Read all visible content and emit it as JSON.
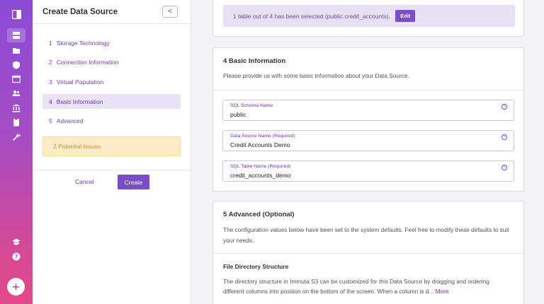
{
  "rail": {
    "icons": [
      "panel-toggle-icon",
      "data-sources-icon",
      "projects-icon",
      "governance-icon",
      "queries-icon",
      "users-icon",
      "institution-icon",
      "audit-icon",
      "tools-icon",
      "tutorials-icon",
      "help-icon"
    ],
    "add_label": "+",
    "accent": "#8a4bd6"
  },
  "wizard": {
    "title": "Create Data Source",
    "collapse_label": "<",
    "steps": [
      {
        "num": "1",
        "label": "Storage Technology"
      },
      {
        "num": "2",
        "label": "Connection Information"
      },
      {
        "num": "3",
        "label": "Virtual Population"
      },
      {
        "num": "4",
        "label": "Basic Information"
      },
      {
        "num": "5",
        "label": "Advanced"
      }
    ],
    "issues_label": "2 Potential Issues",
    "cancel_label": "Cancel",
    "create_label": "Create"
  },
  "top": {
    "banner_text": "1 table out of 4 has been selected (public.credit_accounts).",
    "edit_label": "Edit"
  },
  "basic": {
    "title": "4 Basic Information",
    "description": "Please provide us with some basic information about your Data Source.",
    "fields": [
      {
        "label": "SQL Schema Name",
        "value": "public"
      },
      {
        "label": "Data Source Name (Required)",
        "value": "Credit Accounts Demo"
      },
      {
        "label": "SQL Table Name (Required)",
        "value": "credit_accounts_demo"
      }
    ],
    "help_glyph": "?"
  },
  "advanced": {
    "title": "5 Advanced (Optional)",
    "description_line1": "The configuration values below have been set to the system defaults. Feel free to modify these defaults to suit",
    "description_line2": "your needs.",
    "subsection_title": "File Directory Structure",
    "sub_line1": "The directory structure in Immuta S3 can be customized for this Data Source by dragging and ordering",
    "sub_line2": "different columns into position on the bottom of the screen. When a column is d...",
    "more_label": "More"
  }
}
